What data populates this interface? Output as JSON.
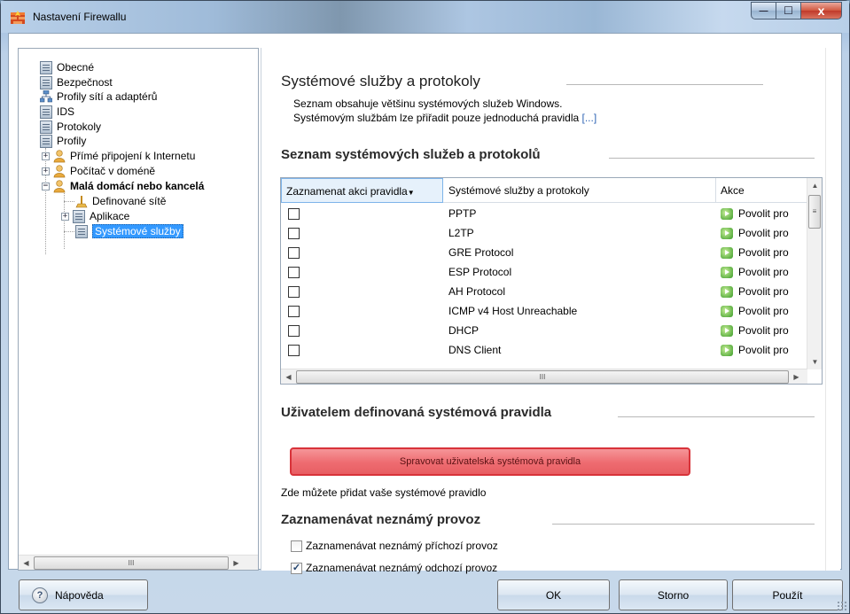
{
  "window": {
    "title": "Nastavení Firewallu",
    "buttons": {
      "minimize": "—",
      "maximize": "☐",
      "close": "x"
    }
  },
  "tree": {
    "items": [
      {
        "label": "Obecné"
      },
      {
        "label": "Bezpečnost"
      },
      {
        "label": "Profily sítí a adaptérů"
      },
      {
        "label": "IDS"
      },
      {
        "label": "Protokoly"
      },
      {
        "label": "Profily"
      },
      {
        "label": "Přímé připojení k Internetu"
      },
      {
        "label": "Počítač v doméně"
      },
      {
        "label": "Malá domácí nebo kancelá"
      },
      {
        "label": "Definované sítě"
      },
      {
        "label": "Aplikace"
      },
      {
        "label": "Systémové služby"
      }
    ],
    "scroll_thumb": "III"
  },
  "main": {
    "title": "Systémové služby a protokoly",
    "desc_line1": "Seznam obsahuje většinu systémových služeb Windows.",
    "desc_line2": "Systémovým službám lze přiřadit pouze jednoduchá pravidla",
    "more_link": "[...]",
    "list_title": "Seznam systémových služeb a protokolů",
    "columns": {
      "log": "Zaznamenat akci pravidla",
      "service": "Systémové služby a protokoly",
      "action": "Akce"
    },
    "rows": [
      {
        "checked": false,
        "service": "PPTP",
        "action": "Povolit pro"
      },
      {
        "checked": false,
        "service": "L2TP",
        "action": "Povolit pro"
      },
      {
        "checked": false,
        "service": "GRE Protocol",
        "action": "Povolit pro"
      },
      {
        "checked": false,
        "service": "ESP Protocol",
        "action": "Povolit pro"
      },
      {
        "checked": false,
        "service": "AH Protocol",
        "action": "Povolit pro"
      },
      {
        "checked": false,
        "service": "ICMP v4 Host Unreachable",
        "action": "Povolit pro"
      },
      {
        "checked": false,
        "service": "DHCP",
        "action": "Povolit pro"
      },
      {
        "checked": false,
        "service": "DNS Client",
        "action": "Povolit pro"
      }
    ],
    "grid_hscroll_thumb": "III",
    "user_rules_title": "Uživatelem definovaná systémová pravidla",
    "manage_button": "Spravovat uživatelská systémová pravidla",
    "user_rules_hint": "Zde můžete přidat vaše systémové pravidlo",
    "unknown_title": "Zaznamenávat neznámý provoz",
    "log_incoming": {
      "label": "Zaznamenávat neznámý příchozí provoz",
      "checked": false
    },
    "log_outgoing": {
      "label": "Zaznamenávat neznámý odchozí provoz",
      "checked": true
    }
  },
  "footer": {
    "help": "Nápověda",
    "ok": "OK",
    "cancel": "Storno",
    "apply": "Použít"
  },
  "colors": {
    "selection": "#3399ff",
    "manage_button": "#ee6b70",
    "link": "#2f65b5",
    "action_icon": "#3a9b27"
  }
}
